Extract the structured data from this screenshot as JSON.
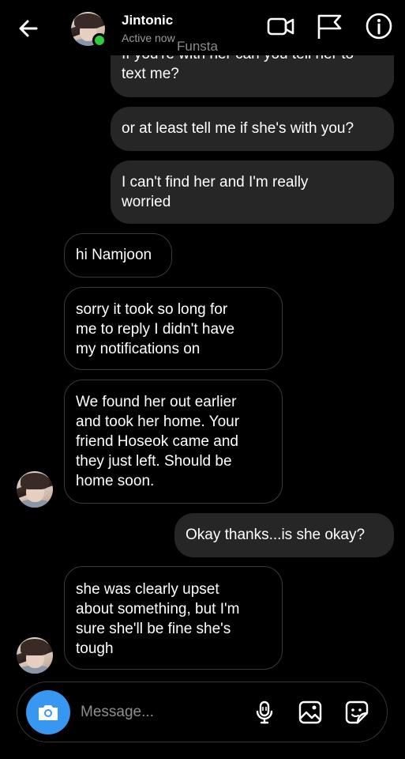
{
  "header": {
    "back_icon": "back-arrow-icon",
    "contact_name": "Jintonic",
    "status": "Active now",
    "watermark": "Funsta",
    "icons": [
      "video-call-icon",
      "flag-icon",
      "info-icon"
    ]
  },
  "messages": [
    {
      "from": "me",
      "text": "If you're with her can you tell her to\ntext me?"
    },
    {
      "from": "me",
      "text": "or at least tell me if she's with you?"
    },
    {
      "from": "me",
      "text": "I can't find her and I'm really\nworried"
    },
    {
      "from": "them",
      "text": "hi Namjoon"
    },
    {
      "from": "them",
      "text": "sorry it took so long for\nme to reply I didn't have\nmy notifications on"
    },
    {
      "from": "them",
      "text": "We found her out earlier\nand took her home. Your\nfriend Hoseok came and\nthey just left. Should be\nhome soon."
    },
    {
      "from": "me",
      "text": "Okay thanks...is she okay?"
    },
    {
      "from": "them",
      "text": "she was clearly upset\nabout something, but I'm\nsure she'll be fine she's\ntough"
    }
  ],
  "composer": {
    "placeholder": "Message...",
    "icons": [
      "camera-icon",
      "microphone-icon",
      "gallery-icon",
      "sticker-icon"
    ]
  },
  "colors": {
    "background": "#000000",
    "sent_bubble": "#262626",
    "received_border": "#3a3a3a",
    "online": "#2ecc40",
    "camera_button": "#3897f0"
  }
}
